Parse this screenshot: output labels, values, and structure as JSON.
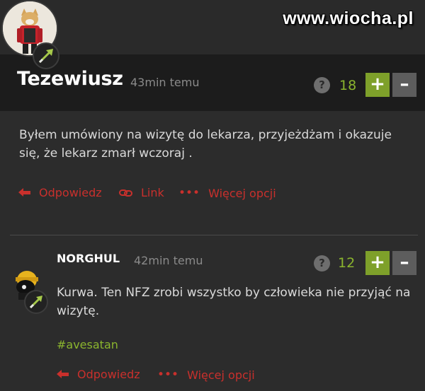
{
  "watermark": "www.wiocha.pl",
  "comment1": {
    "author": "Tezewiusz",
    "time": "43min temu",
    "help": "?",
    "score": "18",
    "plus": "+",
    "minus": "–",
    "text": "Byłem umówiony na wizytę do lekarza, przyjeżdżam i okazuje się, że lekarz zmarł wczoraj .",
    "actions": {
      "reply": "Odpowiedz",
      "link": "Link",
      "more": "Więcej opcji"
    }
  },
  "comment2": {
    "author": "NORGHUL",
    "time": "42min temu",
    "help": "?",
    "score": "12",
    "plus": "+",
    "minus": "–",
    "text": "Kurwa. Ten NFZ zrobi wszystko by człowieka nie przyjąć na wizytę.",
    "tag": "#avesatan",
    "actions": {
      "reply": "Odpowiedz",
      "more": "Więcej opcji"
    }
  },
  "colors": {
    "accent_green": "#8bb52e",
    "action_red": "#c9302c",
    "plus_bg": "#7ea02a",
    "minus_bg": "#5d5d5d"
  },
  "icons": [
    "reply-arrow-icon",
    "chain-link-icon",
    "ellipsis-icon",
    "question-icon",
    "rank-arrow-icon"
  ]
}
